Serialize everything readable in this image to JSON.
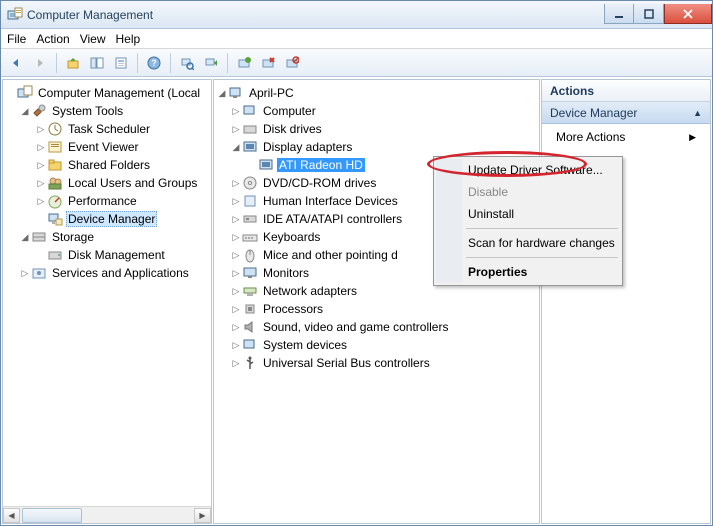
{
  "window": {
    "title": "Computer Management"
  },
  "menu": {
    "file": "File",
    "action": "Action",
    "view": "View",
    "help": "Help"
  },
  "left_tree": {
    "root": "Computer Management (Local",
    "system_tools": "System Tools",
    "task_scheduler": "Task Scheduler",
    "event_viewer": "Event Viewer",
    "shared_folders": "Shared Folders",
    "local_users": "Local Users and Groups",
    "performance": "Performance",
    "device_manager": "Device Manager",
    "storage": "Storage",
    "disk_management": "Disk Management",
    "services": "Services and Applications"
  },
  "mid_tree": {
    "root": "April-PC",
    "computer": "Computer",
    "disk_drives": "Disk drives",
    "display_adapters": "Display adapters",
    "gpu": "ATI Radeon HD",
    "dvd": "DVD/CD-ROM drives",
    "hid": "Human Interface Devices",
    "ide": "IDE ATA/ATAPI controllers",
    "keyboards": "Keyboards",
    "mice": "Mice and other pointing d",
    "monitors": "Monitors",
    "network": "Network adapters",
    "processors": "Processors",
    "sound": "Sound, video and game controllers",
    "system_devices": "System devices",
    "usb": "Universal Serial Bus controllers"
  },
  "actions": {
    "header": "Actions",
    "section": "Device Manager",
    "more": "More Actions"
  },
  "context": {
    "update": "Update Driver Software...",
    "disable": "Disable",
    "uninstall": "Uninstall",
    "scan": "Scan for hardware changes",
    "properties": "Properties"
  }
}
